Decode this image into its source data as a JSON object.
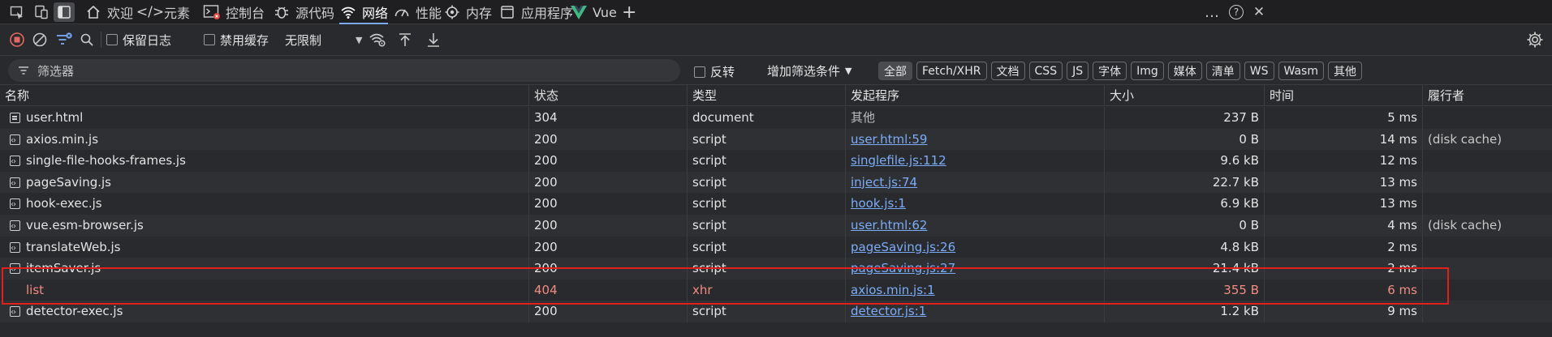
{
  "tabbar": {
    "tabs": [
      {
        "label": "欢迎",
        "icon": "home-icon"
      },
      {
        "label": "元素",
        "icon": "code-icon"
      },
      {
        "label": "控制台",
        "icon": "console-icon"
      },
      {
        "label": "源代码",
        "icon": "bug-icon"
      },
      {
        "label": "网络",
        "icon": "wifi-icon",
        "active": true
      },
      {
        "label": "性能",
        "icon": "gauge-icon"
      },
      {
        "label": "内存",
        "icon": "memory-icon"
      },
      {
        "label": "应用程序",
        "icon": "app-window-icon"
      },
      {
        "label": "Vue",
        "icon": "vue-logo-icon"
      }
    ],
    "add_tab": "+",
    "more": "…",
    "help": "?",
    "close": "✕"
  },
  "toolbar": {
    "preserve_log": "保留日志",
    "disable_cache": "禁用缓存",
    "throttling": "无限制"
  },
  "filterbar": {
    "placeholder": "筛选器",
    "invert": "反转",
    "add_filter": "增加筛选条件",
    "chips": [
      "全部",
      "Fetch/XHR",
      "文档",
      "CSS",
      "JS",
      "字体",
      "Img",
      "媒体",
      "清单",
      "WS",
      "Wasm",
      "其他"
    ]
  },
  "table": {
    "headers": [
      "名称",
      "状态",
      "类型",
      "发起程序",
      "大小",
      "时间",
      "履行者"
    ],
    "rows": [
      {
        "name": "user.html",
        "status": "304",
        "type": "document",
        "initiator": "其他",
        "size": "237 B",
        "time": "5 ms",
        "fulfilled": "",
        "icon": "doc"
      },
      {
        "name": "axios.min.js",
        "status": "200",
        "type": "script",
        "initiator": "user.html:59",
        "size": "0 B",
        "time": "14 ms",
        "fulfilled": "(disk cache)",
        "icon": "script"
      },
      {
        "name": "single-file-hooks-frames.js",
        "status": "200",
        "type": "script",
        "initiator": "singlefile.js:112",
        "size": "9.6 kB",
        "time": "12 ms",
        "fulfilled": "",
        "icon": "script"
      },
      {
        "name": "pageSaving.js",
        "status": "200",
        "type": "script",
        "initiator": "inject.js:74",
        "size": "22.7 kB",
        "time": "13 ms",
        "fulfilled": "",
        "icon": "script"
      },
      {
        "name": "hook-exec.js",
        "status": "200",
        "type": "script",
        "initiator": "hook.js:1",
        "size": "6.9 kB",
        "time": "13 ms",
        "fulfilled": "",
        "icon": "script"
      },
      {
        "name": "vue.esm-browser.js",
        "status": "200",
        "type": "script",
        "initiator": "user.html:62",
        "size": "0 B",
        "time": "4 ms",
        "fulfilled": "(disk cache)",
        "icon": "script"
      },
      {
        "name": "translateWeb.js",
        "status": "200",
        "type": "script",
        "initiator": "pageSaving.js:26",
        "size": "4.8 kB",
        "time": "2 ms",
        "fulfilled": "",
        "icon": "script"
      },
      {
        "name": "itemSaver.js",
        "status": "200",
        "type": "script",
        "initiator": "pageSaving.js:27",
        "size": "21.4 kB",
        "time": "2 ms",
        "fulfilled": "",
        "icon": "script"
      },
      {
        "name": "list",
        "status": "404",
        "type": "xhr",
        "initiator": "axios.min.js:1",
        "size": "355 B",
        "time": "6 ms",
        "fulfilled": "",
        "icon": "",
        "error": true
      },
      {
        "name": "detector-exec.js",
        "status": "200",
        "type": "script",
        "initiator": "detector.js:1",
        "size": "1.2 kB",
        "time": "9 ms",
        "fulfilled": "",
        "icon": "script"
      }
    ]
  }
}
